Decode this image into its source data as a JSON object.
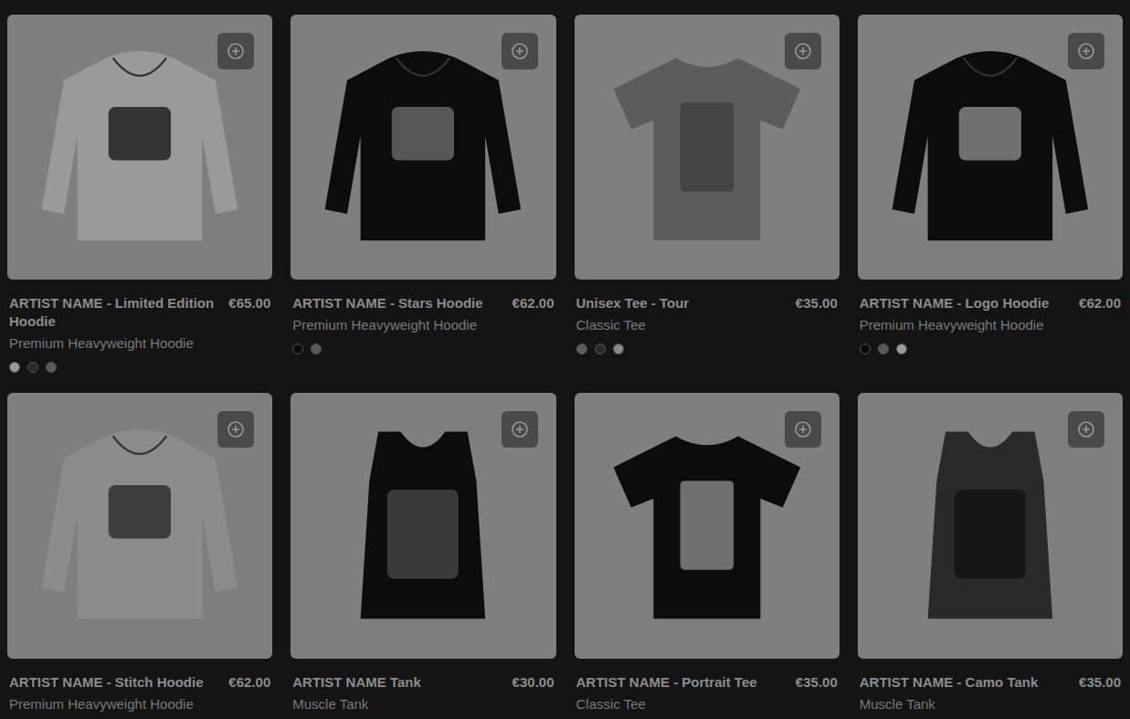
{
  "page": {
    "dimmed": true
  },
  "products": [
    {
      "title": "ARTIST NAME - Limited Edition Hoodie",
      "subtitle": "Premium Heavyweight Hoodie",
      "price": "€65.00",
      "kind": "hoodie",
      "garment": "#9a9a9a",
      "print": "#1a1a1a",
      "colors": [
        "#9a9a9a",
        "#2a2a2a",
        "#5a5a5a"
      ]
    },
    {
      "title": "ARTIST NAME - Stars Hoodie",
      "subtitle": "Premium Heavyweight Hoodie",
      "price": "€62.00",
      "kind": "hoodie",
      "garment": "#0c0c0c",
      "print": "#6a6a6a",
      "colors": [
        "#0c0c0c",
        "#5a5a5a"
      ]
    },
    {
      "title": "Unisex Tee - Tour",
      "subtitle": "Classic Tee",
      "price": "€35.00",
      "kind": "tee",
      "garment": "#5c5c5c",
      "print": "#3a3a3a",
      "colors": [
        "#5c5c5c",
        "#2a2a2a",
        "#8a8a8a"
      ]
    },
    {
      "title": "ARTIST NAME - Logo Hoodie",
      "subtitle": "Premium Heavyweight Hoodie",
      "price": "€62.00",
      "kind": "hoodie",
      "garment": "#0c0c0c",
      "print": "#8a8a8a",
      "colors": [
        "#0c0c0c",
        "#5a5a5a",
        "#9a9a9a"
      ]
    },
    {
      "title": "ARTIST NAME - Stitch Hoodie",
      "subtitle": "Premium Heavyweight Hoodie",
      "price": "€62.00",
      "kind": "hoodie",
      "garment": "#8c8c8c",
      "print": "#2a2a2a",
      "colors": [
        "#8c8c8c",
        "#2a2a2a"
      ]
    },
    {
      "title": "ARTIST NAME Tank",
      "subtitle": "Muscle Tank",
      "price": "€30.00",
      "kind": "tank",
      "garment": "#0c0c0c",
      "print": "#5a5a5a",
      "colors": [
        "#0c0c0c",
        "#8a8a8a"
      ]
    },
    {
      "title": "ARTIST NAME - Portrait Tee",
      "subtitle": "Classic Tee",
      "price": "€35.00",
      "kind": "tee",
      "garment": "#0c0c0c",
      "print": "#9a9a9a",
      "colors": [
        "#0c0c0c",
        "#5a5a5a"
      ]
    },
    {
      "title": "ARTIST NAME - Camo Tank",
      "subtitle": "Muscle Tank",
      "price": "€35.00",
      "kind": "tank",
      "garment": "#2a2a2a",
      "print": "#0c0c0c",
      "colors": [
        "#2a2a2a",
        "#6a6a6a"
      ]
    }
  ]
}
